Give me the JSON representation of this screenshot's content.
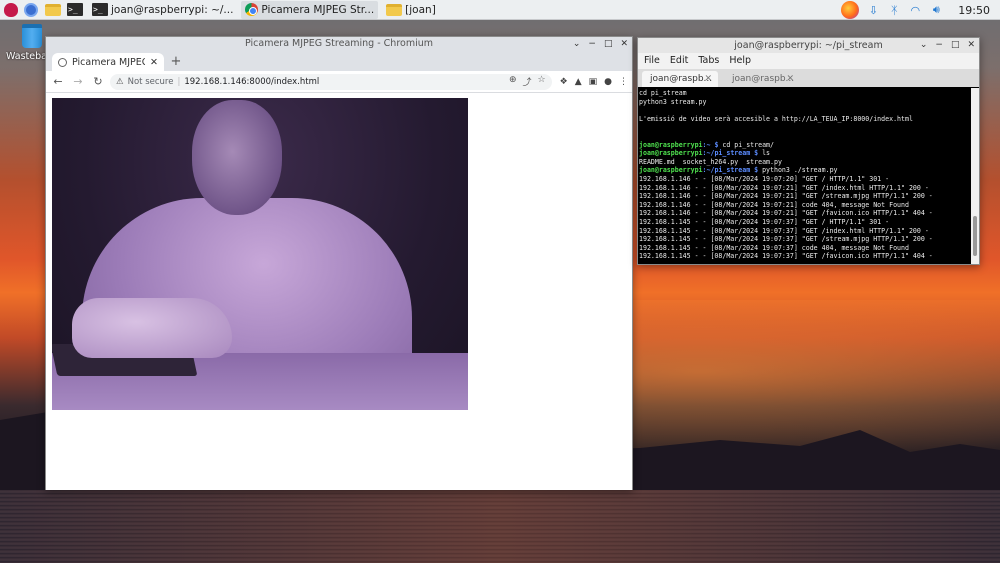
{
  "panel": {
    "tasks": [
      {
        "label": "joan@raspberrypi: ~/..."
      },
      {
        "label": "Picamera MJPEG Str..."
      },
      {
        "label": "[joan]"
      }
    ],
    "clock": "19:50"
  },
  "desktop": {
    "icon_label": "Wastebasket"
  },
  "chromium": {
    "window_title": "Picamera MJPEG Streaming - Chromium",
    "tab_title": "Picamera MJPEG Stream",
    "not_secure": "Not secure",
    "url": "192.168.1.146:8000/index.html"
  },
  "terminal": {
    "window_title": "joan@raspberrypi: ~/pi_stream",
    "menu": [
      "File",
      "Edit",
      "Tabs",
      "Help"
    ],
    "tabs": [
      "joan@raspb...",
      "joan@raspb..."
    ],
    "lines": [
      {
        "text": "cd pi_stream"
      },
      {
        "text": "python3 stream.py"
      },
      {
        "text": ""
      },
      {
        "text": "L'emissió de video serà accesible a http://LA_TEUA_IP:8000/index.html"
      },
      {
        "text": ""
      },
      {
        "text": ""
      },
      {
        "user": "joan@raspberrypi",
        "path": ":~ $ ",
        "text": "cd pi_stream/"
      },
      {
        "user": "joan@raspberrypi",
        "path": ":~/pi_stream $ ",
        "text": "ls"
      },
      {
        "text": "README.md  socket_h264.py  stream.py"
      },
      {
        "user": "joan@raspberrypi",
        "path": ":~/pi_stream $ ",
        "text": "python3 ./stream.py"
      },
      {
        "text": "192.168.1.146 - - [08/Mar/2024 19:07:20] \"GET / HTTP/1.1\" 301 -"
      },
      {
        "text": "192.168.1.146 - - [08/Mar/2024 19:07:21] \"GET /index.html HTTP/1.1\" 200 -"
      },
      {
        "text": "192.168.1.146 - - [08/Mar/2024 19:07:21] \"GET /stream.mjpg HTTP/1.1\" 200 -"
      },
      {
        "text": "192.168.1.146 - - [08/Mar/2024 19:07:21] code 404, message Not Found"
      },
      {
        "text": "192.168.1.146 - - [08/Mar/2024 19:07:21] \"GET /favicon.ico HTTP/1.1\" 404 -"
      },
      {
        "text": "192.168.1.145 - - [08/Mar/2024 19:07:37] \"GET / HTTP/1.1\" 301 -"
      },
      {
        "text": "192.168.1.145 - - [08/Mar/2024 19:07:37] \"GET /index.html HTTP/1.1\" 200 -"
      },
      {
        "text": "192.168.1.145 - - [08/Mar/2024 19:07:37] \"GET /stream.mjpg HTTP/1.1\" 200 -"
      },
      {
        "text": "192.168.1.145 - - [08/Mar/2024 19:07:37] code 404, message Not Found"
      },
      {
        "text": "192.168.1.145 - - [08/Mar/2024 19:07:37] \"GET /favicon.ico HTTP/1.1\" 404 -"
      }
    ]
  }
}
